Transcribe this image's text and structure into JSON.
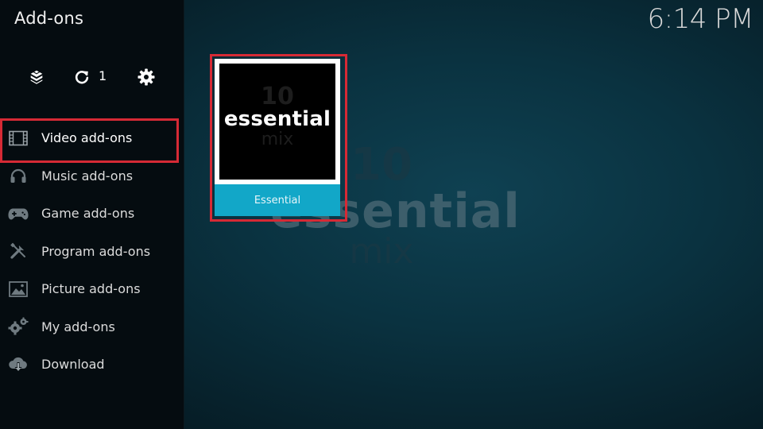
{
  "window": {
    "title": "Add-ons",
    "clock": "6:14 PM"
  },
  "toolbar": {
    "install_icon": "dropbox-box-icon",
    "update_icon": "refresh-icon",
    "update_count": "1",
    "settings_icon": "gear-icon"
  },
  "menu": {
    "items": [
      {
        "label": "Video add-ons",
        "icon": "film-strip-icon",
        "active": true
      },
      {
        "label": "Music add-ons",
        "icon": "headphones-icon"
      },
      {
        "label": "Game add-ons",
        "icon": "gamepad-icon"
      },
      {
        "label": "Program add-ons",
        "icon": "tools-icon"
      },
      {
        "label": "Picture add-ons",
        "icon": "picture-icon"
      },
      {
        "label": "My add-ons",
        "icon": "gears-icon"
      },
      {
        "label": "Download",
        "icon": "cloud-download-icon"
      }
    ]
  },
  "background": {
    "top": "10",
    "title": "essential",
    "sub": "mix"
  },
  "addon": {
    "name": "Essential",
    "art_top": "10",
    "art_title": "essential",
    "art_sub": "mix"
  },
  "colors": {
    "highlight": "#d62a35",
    "tile_label_bg": "#12a7c8",
    "sidebar_bg": "#050c10"
  }
}
